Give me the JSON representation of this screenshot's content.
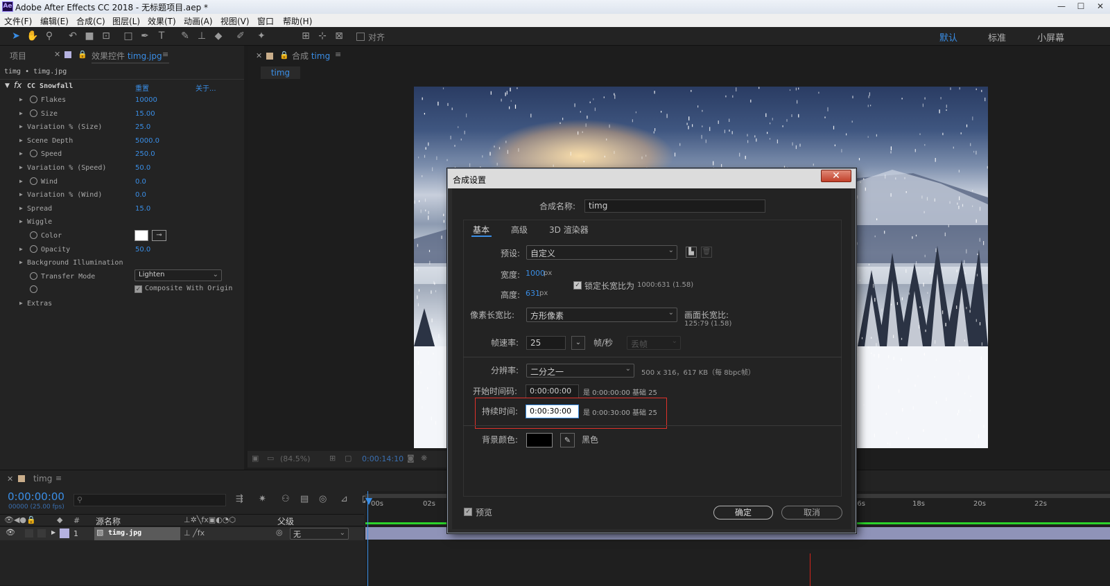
{
  "titlebar": {
    "logo": "Ae",
    "title": "Adobe After Effects CC 2018 - 无标题项目.aep *",
    "min": "—",
    "max": "☐",
    "close": "✕"
  },
  "menu": [
    "文件(F)",
    "编辑(E)",
    "合成(C)",
    "图层(L)",
    "效果(T)",
    "动画(A)",
    "视图(V)",
    "窗口",
    "帮助(H)"
  ],
  "toolbar": {
    "align_label": "对齐"
  },
  "workspaces": {
    "default": "默认",
    "standard": "标准",
    "small": "小屏幕"
  },
  "left_panel": {
    "tab_project": "项目",
    "tab_effects_prefix": "效果控件",
    "tab_effects_file": "timg.jpg",
    "breadcrumb": "timg • timg.jpg",
    "effect_name": "CC Snowfall",
    "reset": "重置",
    "about": "关于...",
    "properties": [
      {
        "label": "Flakes",
        "value": "10000",
        "stopwatch": true,
        "expand": true
      },
      {
        "label": "Size",
        "value": "15.00",
        "stopwatch": true,
        "expand": true
      },
      {
        "label": "Variation % (Size)",
        "value": "25.0",
        "stopwatch": false,
        "expand": true
      },
      {
        "label": "Scene Depth",
        "value": "5000.0",
        "stopwatch": false,
        "expand": true
      },
      {
        "label": "Speed",
        "value": "250.0",
        "stopwatch": true,
        "expand": true
      },
      {
        "label": "Variation % (Speed)",
        "value": "50.0",
        "stopwatch": false,
        "expand": true
      },
      {
        "label": "Wind",
        "value": "0.0",
        "stopwatch": true,
        "expand": true
      },
      {
        "label": "Variation % (Wind)",
        "value": "0.0",
        "stopwatch": false,
        "expand": true
      },
      {
        "label": "Spread",
        "value": "15.0",
        "stopwatch": false,
        "expand": true
      },
      {
        "label": "Wiggle",
        "value": "",
        "stopwatch": false,
        "expand": true
      },
      {
        "label": "Color",
        "value": "",
        "stopwatch": true,
        "expand": false
      },
      {
        "label": "Opacity",
        "value": "50.0",
        "stopwatch": true,
        "expand": true
      },
      {
        "label": "Background Illumination",
        "value": "",
        "stopwatch": false,
        "expand": true
      },
      {
        "label": "Transfer Mode",
        "value": "",
        "stopwatch": true,
        "expand": false
      },
      {
        "label": "",
        "value": "",
        "stopwatch": true,
        "expand": false
      },
      {
        "label": "Extras",
        "value": "",
        "stopwatch": false,
        "expand": true
      }
    ],
    "transfer_mode": "Lighten",
    "composite_with_original": "Composite With Origin"
  },
  "comp_panel": {
    "tab_prefix": "合成",
    "tab_name": "timg",
    "subtab": "timg",
    "zoom": "(84.5%)",
    "timecode": "0:00:14:10"
  },
  "dialog": {
    "title": "合成设置",
    "close": "✕",
    "name_label": "合成名称:",
    "name_value": "timg",
    "tabs": [
      "基本",
      "高级",
      "3D 渲染器"
    ],
    "preset_label": "预设:",
    "preset_value": "自定义",
    "width_label": "宽度:",
    "width_value": "1000",
    "height_label": "高度:",
    "height_value": "631",
    "px": "px",
    "lock_label": "锁定长宽比为",
    "lock_ratio": "1000:631 (1.58)",
    "par_label": "像素长宽比:",
    "par_value": "方形像素",
    "frame_aspect_label": "画面长宽比:",
    "frame_aspect_value": "125:79 (1.58)",
    "fps_label": "帧速率:",
    "fps_value": "25",
    "fps_unit": "帧/秒",
    "drop_frame": "丢帧",
    "res_label": "分辨率:",
    "res_value": "二分之一",
    "res_info": "500 x 316，617 KB（每 8bpc帧）",
    "start_label": "开始时间码:",
    "start_value": "0:00:00:00",
    "start_info": "是 0:00:00:00  基础 25",
    "dur_label": "持续时间:",
    "dur_value": "0:00:30:00",
    "dur_info": "是 0:00:30:00  基础 25",
    "bg_label": "背景颜色:",
    "bg_name": "黑色",
    "bg_color": "#000000",
    "preview": "预览",
    "ok": "确定",
    "cancel": "取消"
  },
  "timeline": {
    "tab": "timg",
    "timecode": "0:00:00:00",
    "fps_info": "00000 (25.00 fps)",
    "search_placeholder": "",
    "col_number": "#",
    "col_name": "源名称",
    "col_parent": "父级",
    "layer_index": "1",
    "layer_name": "timg.jpg",
    "parent_value": "无",
    "ruler": [
      "00s",
      "02s",
      "16s",
      "18s",
      "20s",
      "22s"
    ]
  },
  "colors": {
    "accent": "#3a8ee6",
    "highlight_box": "#e0322b",
    "layer_bar": "#8f93b8"
  }
}
